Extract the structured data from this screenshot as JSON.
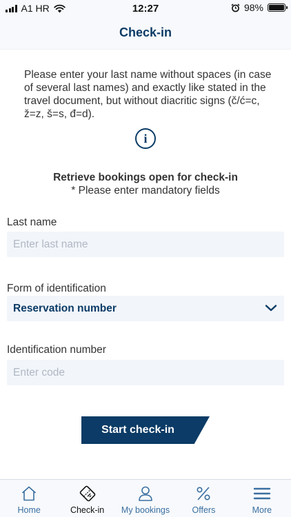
{
  "status_bar": {
    "carrier": "A1 HR",
    "time": "12:27",
    "battery": "98%",
    "battery_level": 0.98
  },
  "header": {
    "title": "Check-in"
  },
  "intro_text": "Please enter your last name without spaces (in case of several last names) and exactly like stated in the travel document, but without diacritic signs (č/ć=c, ž=z, š=s, đ=d).",
  "info_icon": "i",
  "retrieve": {
    "title": "Retrieve bookings open for check-in",
    "subtitle": "* Please enter mandatory fields"
  },
  "form": {
    "last_name": {
      "label": "Last name",
      "placeholder": "Enter last name",
      "value": ""
    },
    "identification_form": {
      "label": "Form of identification",
      "value": "Reservation number"
    },
    "identification_number": {
      "label": "Identification number",
      "placeholder": "Enter code",
      "value": ""
    }
  },
  "start_button": "Start check-in",
  "tabs": [
    {
      "label": "Home",
      "icon": "home-icon",
      "active": false
    },
    {
      "label": "Check-in",
      "icon": "boarding-pass-icon",
      "active": true
    },
    {
      "label": "My bookings",
      "icon": "person-icon",
      "active": false
    },
    {
      "label": "Offers",
      "icon": "percent-icon",
      "active": false
    },
    {
      "label": "More",
      "icon": "menu-icon",
      "active": false
    }
  ],
  "colors": {
    "brand": "#0b3b66",
    "tab_inactive": "#3a6fa0",
    "field_bg": "#f2f5fa",
    "placeholder": "#b0b8c4"
  }
}
